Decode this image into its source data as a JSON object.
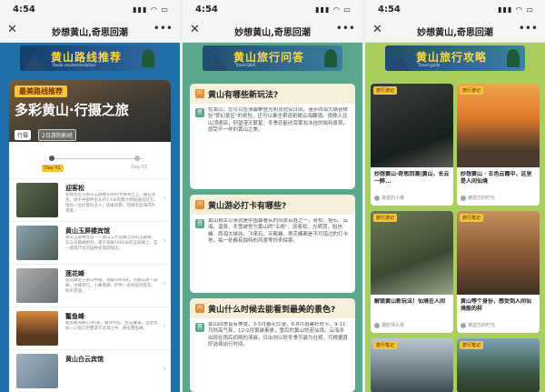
{
  "status": {
    "time": "4:54",
    "signal": "▮▮▮ ◠ ▭"
  },
  "icons": {
    "close": "close-icon",
    "more": "more-icon",
    "arrow": "chevron-right-icon"
  },
  "phones": [
    {
      "title": "妙想黄山,奇思回潮",
      "banner": "黄山路线推荐",
      "banner_sub": "Route recommendation"
    },
    {
      "title": "妙想黄山,奇思回潮",
      "banner": "黄山旅行问答",
      "banner_sub": "Travel Q&A"
    },
    {
      "title": "妙想黄山,奇思回潮",
      "banner": "黄山旅行攻略",
      "banner_sub": "Travel guide"
    }
  ],
  "route": {
    "tag": "最美路线推荐",
    "title": "多彩黄山·行摄之旅",
    "chips": [
      "行摄",
      "2日游的影经"
    ],
    "day1": "Day 01",
    "day2": "Day 02",
    "places": [
      {
        "name": "迎客松",
        "desc": "迎客松位于黄山玉屏楼东侧的文殊洞之上，破石而生，树干中部伸出长达7.6米的两大侧枝展向前方，恰似一位好客的主人，挥展双臂，热情欢迎海内外宾客。"
      },
      {
        "name": "黄山玉屏楼宾馆",
        "desc": "黄山玉屏楼宾馆——黄山三大名峰之间的玉屏峰，东与天都峰相对，建于海拔1680米的玉屏峰上，是一座现代化的园林式旅游饭店。"
      },
      {
        "name": "莲花峰",
        "desc": "莲花峰位于黄山中部，海拔1864米，为黄山第一高峰，主峰突兀，小峰簇拥，俨然一朵初绽的莲花，仰天怒放。"
      },
      {
        "name": "鳌鱼峰",
        "desc": "鳌鱼峰海拔1780米，峰顶平坦，巨石叠置，远望犹如一只张口巨鳌游于云海之中，故名鳌鱼峰。"
      },
      {
        "name": "黄山白云宾馆",
        "desc": ""
      }
    ]
  },
  "qa": [
    {
      "q": "黄山有哪些新玩法?",
      "a": "在黄山，您可以在清晨攀登光明顶欣赏日出，漫步西海大峡谷体验\"梦幻景区\"的奇险，还可以乘坐索道俯瞰云海翻涌。夜晚入住山顶酒店，仰望漫天繁星；冬季还能欣赏雾凇冰挂的独特景观，感受不一样的黄山之美。"
    },
    {
      "q": "黄山游必打卡有哪些?",
      "a": "黄山自古以来就是中国最著名的风景名胜之一，奇松、怪石、云海、温泉、冬雪被誉为黄山的\"五绝\"。迎客松、光明顶、始信峰、西海大峡谷、飞来石、天都峰、莲花峰都是不可错过的打卡地，每一处都有独特的风景等你来探索。"
    },
    {
      "q": "黄山什么时候去能看到最美的景色?",
      "a": "黄山四季皆有美景，3-5月春花烂漫，6-8月避暑好时节，9-11月秋高气爽，12-2月银装素裹，雪后的黄山恍若仙境。云海多出现在雨后初晴的清晨，日出则以秋冬季节最为壮观，可根据喜好选择出行时间。"
    }
  ],
  "guide": [
    {
      "tag": "旅行游记",
      "title": "妙想黄山·奇思回潮|黄山，长云一醉...",
      "author": "浪迹的小琳"
    },
    {
      "tag": "旅行游记",
      "title": "妙想黄山 · 五色云霞中，这里是人间仙境",
      "author": "被遗忘的时光"
    },
    {
      "tag": "旅行游记",
      "title": "解锁黄山新玩法！仙境在人间",
      "author": "摄影师么我"
    },
    {
      "tag": "旅行笔记",
      "title": "黄山等个身份，感受到人间仙境般的样",
      "author": "被遗忘的时光"
    },
    {
      "tag": "旅行笔记",
      "title": "",
      "author": ""
    },
    {
      "tag": "旅行笔记",
      "title": "",
      "author": ""
    }
  ]
}
